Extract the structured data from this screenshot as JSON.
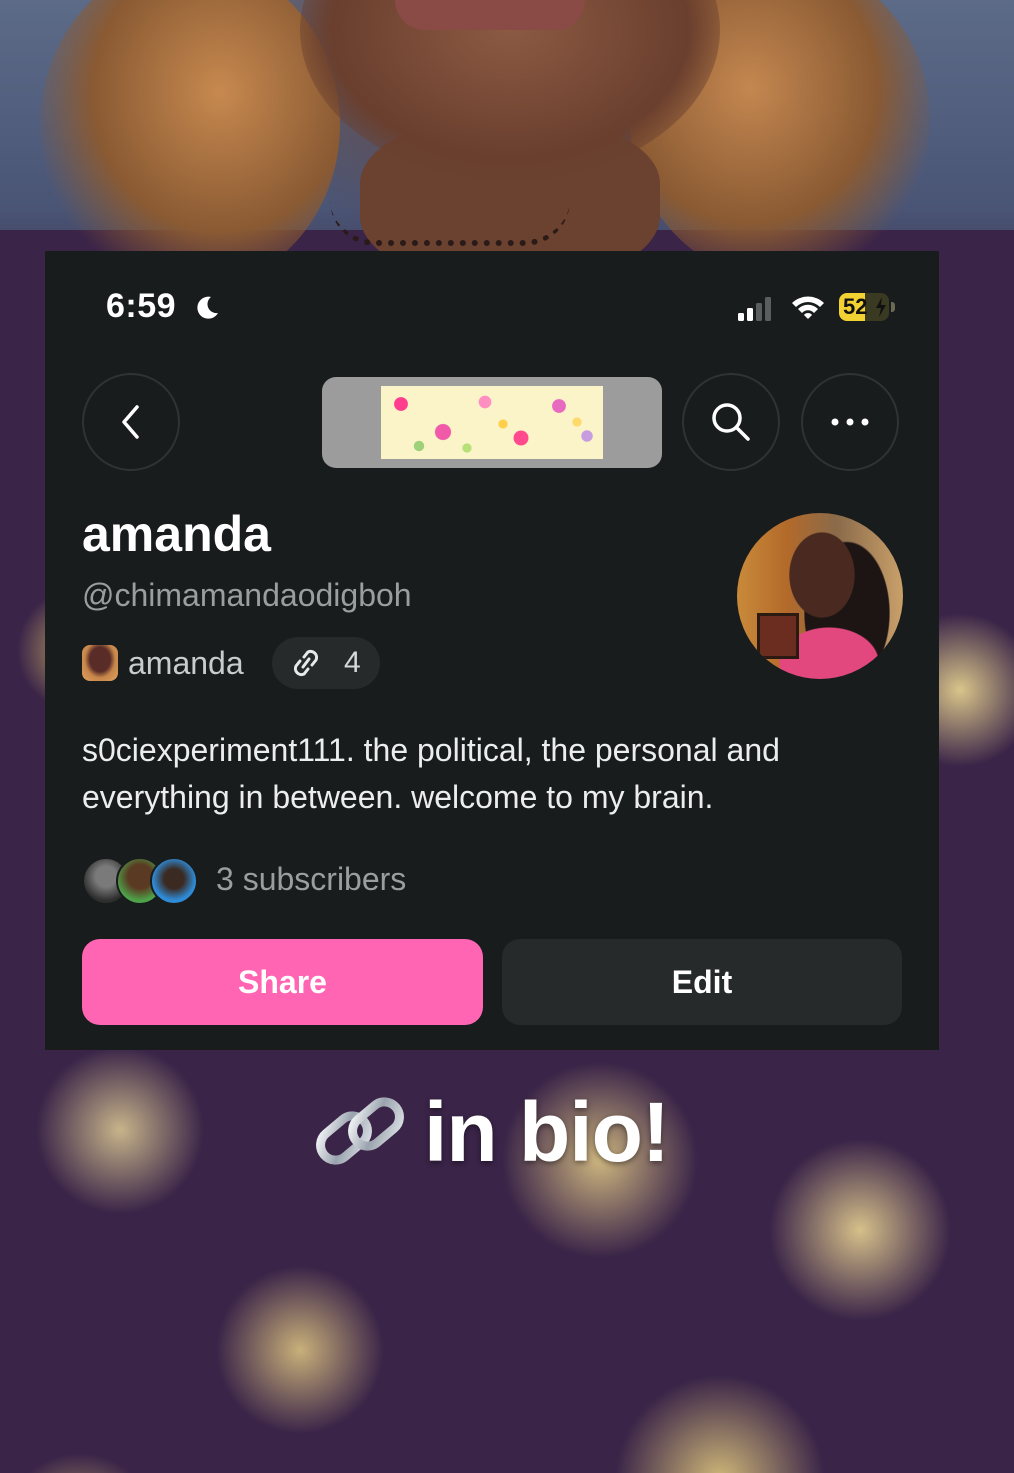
{
  "status_bar": {
    "time": "6:59",
    "battery_level": "52",
    "battery_fraction": 0.52,
    "icons": [
      "moon-icon",
      "signal-icon",
      "wifi-icon",
      "battery-icon"
    ]
  },
  "nav": {
    "back_icon": "chevron-left-icon",
    "search_icon": "search-icon",
    "more_icon": "ellipsis-icon"
  },
  "profile": {
    "name": "amanda",
    "handle": "@chimamandaodigboh",
    "linked_account_name": "amanda",
    "links_count": "4",
    "bio": "s0ciexperiment111. the political, the personal and everything in between. welcome to my brain.",
    "subscribers": "3 subscribers"
  },
  "actions": {
    "share_label": "Share",
    "edit_label": "Edit"
  },
  "caption": {
    "text": "in bio!",
    "icon": "chain-link-icon"
  },
  "colors": {
    "card_bg": "#191c1d",
    "accent_pink": "#ff65b2",
    "secondary_button": "#262a2b",
    "battery_yellow": "#f2d232"
  }
}
